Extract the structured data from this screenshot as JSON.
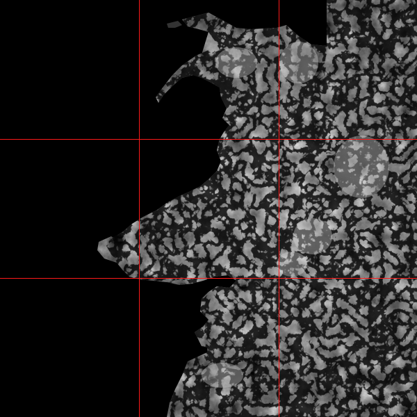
{
  "map": {
    "kind": "grayscale elevation raster",
    "background_color": "#000000",
    "land_color_low": "#1c1c1c",
    "land_color_high": "#f2f2f2",
    "valley_color": "#0a0a0a",
    "grid_color": "#ff1a1a",
    "grid": {
      "columns": 3,
      "rows": 3
    }
  }
}
